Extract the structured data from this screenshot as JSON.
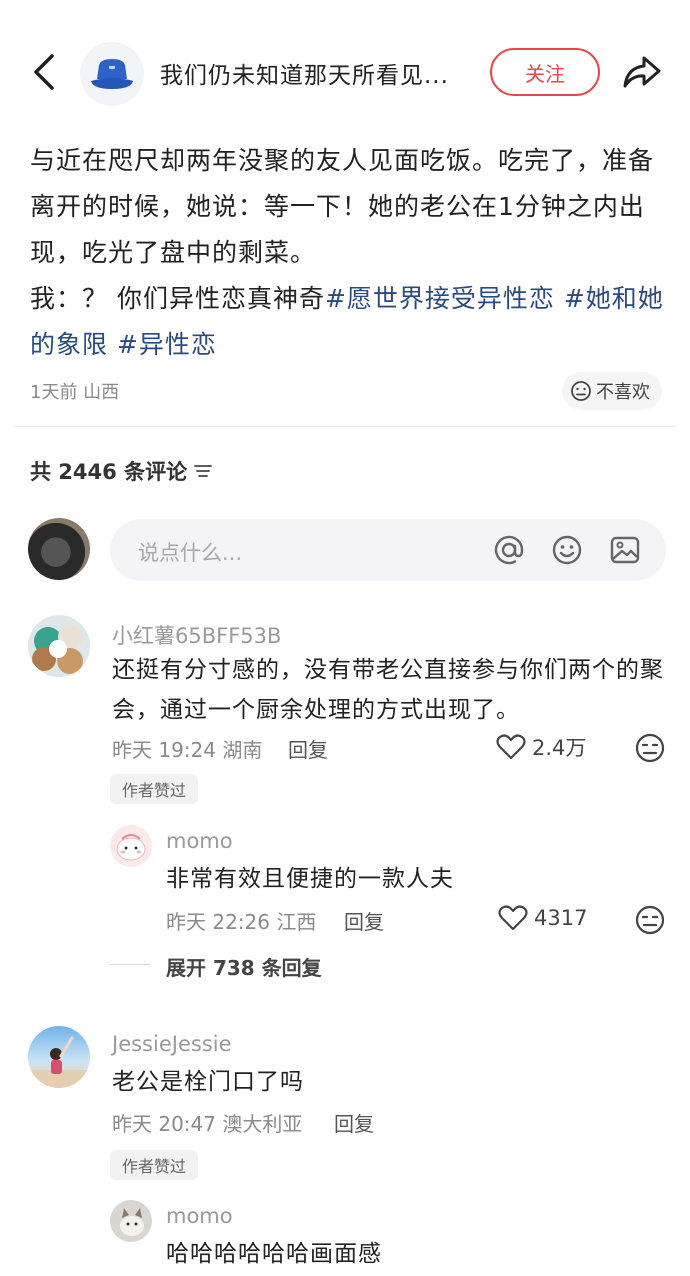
{
  "header": {
    "title": "我们仍未知道那天所看见...",
    "follow_label": "关注"
  },
  "post": {
    "line1": "与近在咫尺却两年没聚的友人见面吃饭。吃完了，准备离开的时候，她说：等一下！她的老公在1分钟之内出现，吃光了盘中的剩菜。",
    "line2_prefix": "我：？ 你们异性恋真神奇",
    "tags": [
      "#愿世界接受异性恋",
      "#她和她的象限",
      "#异性恋"
    ],
    "meta": "1天前 山西",
    "dislike_label": "不喜欢"
  },
  "comments_header": {
    "count_text": "共 2446 条评论"
  },
  "comment_input": {
    "placeholder": "说点什么..."
  },
  "comments": [
    {
      "name": "小红薯65BFF53B",
      "text": "还挺有分寸感的，没有带老公直接参与你们两个的聚会，通过一个厨余处理的方式出现了。",
      "meta": "昨天 19:24 湖南",
      "reply_label": "回复",
      "likes": "2.4万",
      "badge": "作者赞过",
      "replies": [
        {
          "name": "momo",
          "text": "非常有效且便捷的一款人夫",
          "meta": "昨天 22:26 江西",
          "reply_label": "回复",
          "likes": "4317"
        }
      ],
      "expand_label": "展开 738 条回复"
    },
    {
      "name": "JessieJessie",
      "text": "老公是栓门口了吗",
      "meta": "昨天 20:47 澳大利亚",
      "reply_label": "回复",
      "badge": "作者赞过",
      "replies": [
        {
          "name": "momo",
          "text": "哈哈哈哈哈哈画面感"
        }
      ]
    }
  ],
  "colors": {
    "accent_red": "#e5484d",
    "tag_blue": "#2b4b80"
  }
}
